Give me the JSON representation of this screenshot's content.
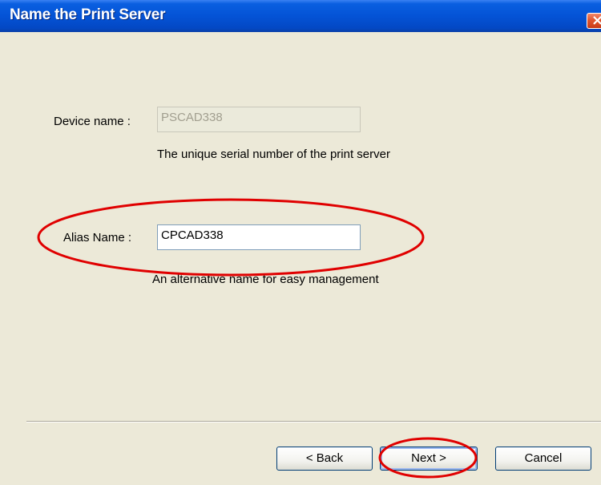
{
  "window": {
    "title": "Name the Print Server",
    "close_glyph": "×"
  },
  "device": {
    "label": "Device name :",
    "value": "PSCAD338",
    "description": "The unique serial number of the print server"
  },
  "alias": {
    "label": "Alias Name :",
    "value": "CPCAD338",
    "description": "An alternative name for easy management"
  },
  "buttons": {
    "back": "< Back",
    "next": "Next >",
    "cancel": "Cancel"
  },
  "annotation_color": "#e00000"
}
